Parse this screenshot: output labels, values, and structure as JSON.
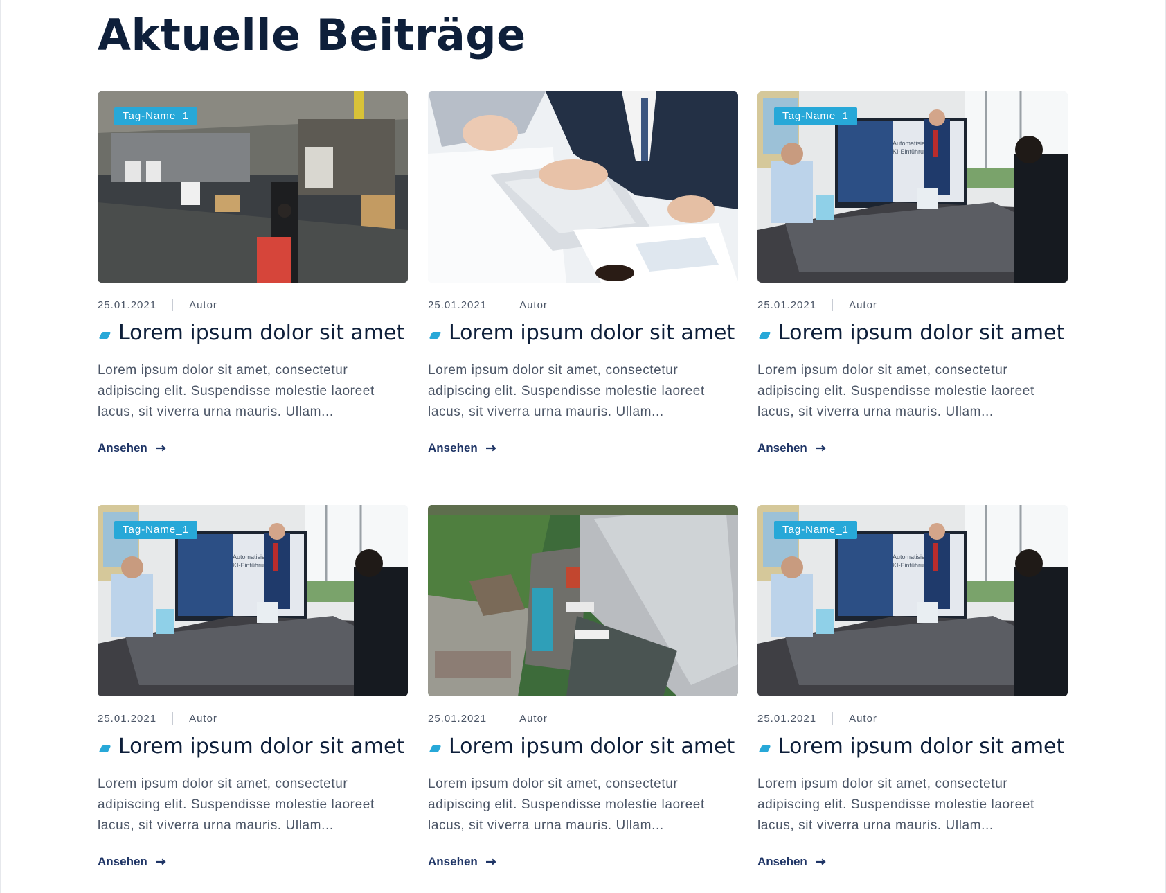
{
  "section": {
    "heading": "Aktuelle Beiträge"
  },
  "colors": {
    "accent": "#27a8d8",
    "heading": "#0e1f3a",
    "link": "#1f3566",
    "body_text": "#4b5566"
  },
  "posts": [
    {
      "image": "warehouse-photo",
      "tag": "Tag-Name_1",
      "date": "25.01.2021",
      "author": "Autor",
      "title": "Lorem ipsum dolor sit amet",
      "excerpt": "Lorem ipsum dolor sit amet, consectetur adipiscing elit. Suspendisse molestie laoreet lacus, sit viverra urna mauris. Ullam...",
      "link": "Ansehen"
    },
    {
      "image": "business-laptop-photo",
      "tag": "",
      "date": "25.01.2021",
      "author": "Autor",
      "title": "Lorem ipsum dolor sit amet",
      "excerpt": "Lorem ipsum dolor sit amet, consectetur adipiscing elit. Suspendisse molestie laoreet lacus, sit viverra urna mauris. Ullam...",
      "link": "Ansehen"
    },
    {
      "image": "meeting-presentation-photo",
      "tag": "Tag-Name_1",
      "date": "25.01.2021",
      "author": "Autor",
      "title": "Lorem ipsum dolor sit amet",
      "excerpt": "Lorem ipsum dolor sit amet, consectetur adipiscing elit. Suspendisse molestie laoreet lacus, sit viverra urna mauris. Ullam...",
      "link": "Ansehen"
    },
    {
      "image": "meeting-presentation-photo",
      "tag": "Tag-Name_1",
      "date": "25.01.2021",
      "author": "Autor",
      "title": "Lorem ipsum dolor sit amet",
      "excerpt": "Lorem ipsum dolor sit amet, consectetur adipiscing elit. Suspendisse molestie laoreet lacus, sit viverra urna mauris. Ullam...",
      "link": "Ansehen"
    },
    {
      "image": "aerial-warehouse-photo",
      "tag": "",
      "date": "25.01.2021",
      "author": "Autor",
      "title": "Lorem ipsum dolor sit amet",
      "excerpt": "Lorem ipsum dolor sit amet, consectetur adipiscing elit. Suspendisse molestie laoreet lacus, sit viverra urna mauris. Ullam...",
      "link": "Ansehen"
    },
    {
      "image": "meeting-presentation-photo",
      "tag": "Tag-Name_1",
      "date": "25.01.2021",
      "author": "Autor",
      "title": "Lorem ipsum dolor sit amet",
      "excerpt": "Lorem ipsum dolor sit amet, consectetur adipiscing elit. Suspendisse molestie laoreet lacus, sit viverra urna mauris. Ullam...",
      "link": "Ansehen"
    }
  ],
  "screen_text": {
    "slide_title": "Automatisierung & KI-Einführung"
  }
}
